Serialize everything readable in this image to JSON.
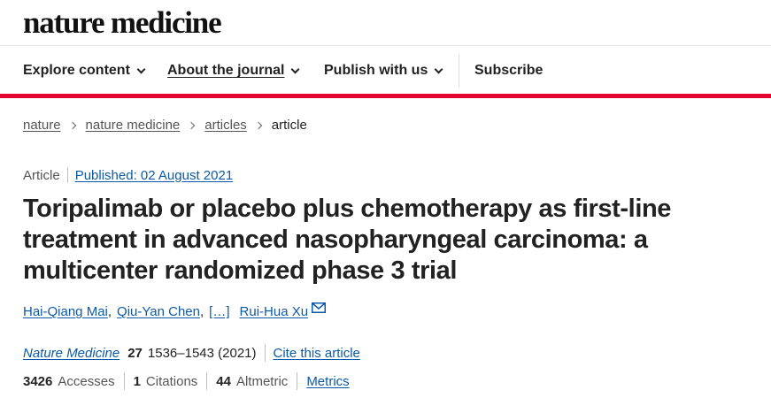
{
  "site": {
    "brand": "nature medicine"
  },
  "nav": {
    "explore": "Explore content",
    "about": "About the journal",
    "publish": "Publish with us",
    "subscribe": "Subscribe"
  },
  "breadcrumb": [
    "nature",
    "nature medicine",
    "articles",
    "article"
  ],
  "article": {
    "type": "Article",
    "published": "Published: 02 August 2021",
    "title": "Toripalimab or placebo plus chemotherapy as first-line treatment in advanced nasopharyngeal carcinoma: a multicenter randomized phase 3 trial",
    "authors": {
      "first": "Hai-Qiang Mai",
      "second": "Qiu-Yan Chen",
      "more": "[…]",
      "last": "Rui-Hua Xu"
    },
    "citation": {
      "journal": "Nature Medicine",
      "volume": "27",
      "pages": "1536–1543 (2021)",
      "cite_link": "Cite this article"
    },
    "metrics": {
      "accesses_value": "3426",
      "accesses_label": "Accesses",
      "citations_value": "1",
      "citations_label": "Citations",
      "altmetric_value": "44",
      "altmetric_label": "Altmetric",
      "metrics_link": "Metrics"
    }
  },
  "colors": {
    "accent_red": "#e4032e",
    "link_blue": "#0b5aa8",
    "text": "#222222"
  },
  "icons": {
    "nav_dropdown": "chevron-down-icon",
    "breadcrumb_separator": "chevron-right-icon",
    "author_contact": "mail-icon"
  }
}
